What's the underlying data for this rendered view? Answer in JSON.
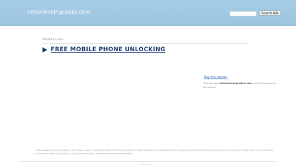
{
  "header": {
    "site_title": "cellunlockingcodes.com",
    "search_placeholder": "",
    "search_button_label": "Search Ads"
  },
  "main": {
    "related_links_label": "Related Links",
    "links": [
      {
        "label": "FREE MOBILE PHONE UNLOCKING"
      }
    ]
  },
  "sidebar": {
    "buy_link_label": "Buy this domain",
    "buy_text_prefix": "The domain",
    "buy_text_domain": "cellunlockingcodes.com",
    "buy_text_suffix": "may be for sale by its owner!"
  },
  "footer": {
    "disclaimer": "This webpage was generated by the domain owner using Sedo Domain Parking. Disclaimer: Sedo maintains no relationship with third party advertisers. Reference to any specific service or trade mark is not controlled by Sedo nor does it constitute or imply its association, endorsement or recommendation.",
    "privacy_label": "Privacy Policy"
  },
  "colors": {
    "header_bg": "#a7cde6",
    "link": "#1f3b75",
    "buy_link": "#2a6db0"
  }
}
